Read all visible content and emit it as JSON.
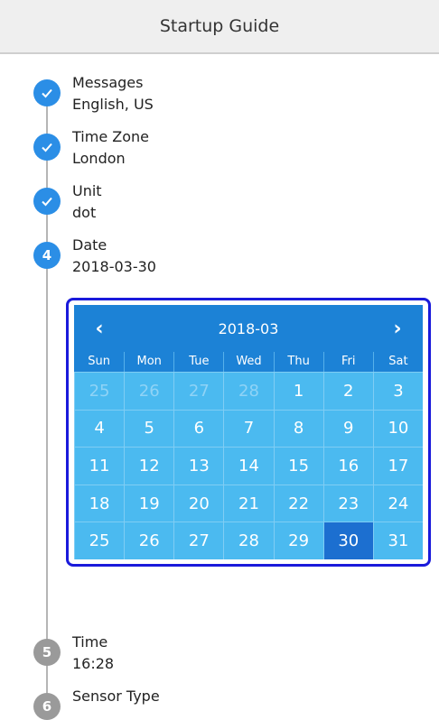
{
  "header": {
    "title": "Startup Guide"
  },
  "steps": [
    {
      "number": "1",
      "label": "Messages",
      "value": "English, US",
      "state": "done"
    },
    {
      "number": "2",
      "label": "Time Zone",
      "value": "London",
      "state": "done"
    },
    {
      "number": "3",
      "label": "Unit",
      "value": "dot",
      "state": "done"
    },
    {
      "number": "4",
      "label": "Date",
      "value": "2018-03-30",
      "state": "active"
    },
    {
      "number": "5",
      "label": "Time",
      "value": "16:28",
      "state": "pending"
    },
    {
      "number": "6",
      "label": "Sensor Type",
      "value": "",
      "state": "pending"
    }
  ],
  "calendar": {
    "month_label": "2018-03",
    "prev_glyph": "‹",
    "next_glyph": "›",
    "weekdays": [
      "Sun",
      "Mon",
      "Tue",
      "Wed",
      "Thu",
      "Fri",
      "Sat"
    ],
    "days": [
      "25",
      "26",
      "27",
      "28",
      "1",
      "2",
      "3",
      "4",
      "5",
      "6",
      "7",
      "8",
      "9",
      "10",
      "11",
      "12",
      "13",
      "14",
      "15",
      "16",
      "17",
      "18",
      "19",
      "20",
      "21",
      "22",
      "23",
      "24",
      "25",
      "26",
      "27",
      "28",
      "29",
      "30",
      "31"
    ],
    "muted_days_count": 4,
    "selected_day": "30"
  },
  "colors": {
    "accent": "#2b8ee6",
    "calendar_header": "#1c82d6",
    "calendar_body": "#4bbaf0",
    "selected_day": "#1c6fd0",
    "focus_frame": "#1a1adb",
    "pending_step": "#9a9a9a"
  }
}
